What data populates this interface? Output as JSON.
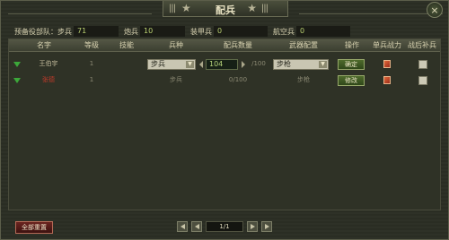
{
  "window": {
    "title": "配兵",
    "close_label": "×"
  },
  "reserve": {
    "label": "预备役部队：",
    "items": [
      {
        "label": "步兵",
        "value": "71"
      },
      {
        "label": "炮兵",
        "value": "10"
      },
      {
        "label": "装甲兵",
        "value": "0"
      },
      {
        "label": "航空兵",
        "value": "0"
      }
    ]
  },
  "table": {
    "headers": [
      "名字",
      "等级",
      "技能",
      "兵种",
      "配兵数量",
      "武器配置",
      "操作",
      "单兵战力",
      "战后补兵"
    ],
    "rows": [
      {
        "name": "王伯宇",
        "level": "1",
        "skill": "",
        "troop_type": "步兵",
        "quantity": "104",
        "quantity_max": "/100",
        "weapon": "步枪",
        "action": "确定",
        "name_color": "#c8c0a0"
      },
      {
        "name": "张德",
        "level": "1",
        "skill": "",
        "troop_type": "步兵",
        "quantity": "",
        "quantity_max": "0/100",
        "weapon": "步枪",
        "action": "修改",
        "name_color": "#c23a2a"
      }
    ]
  },
  "footer": {
    "reset_label": "全部重置",
    "page_indicator": "1/1"
  },
  "colors": {
    "accent_green": "#b9d070",
    "reset_red": "#6b2420"
  }
}
